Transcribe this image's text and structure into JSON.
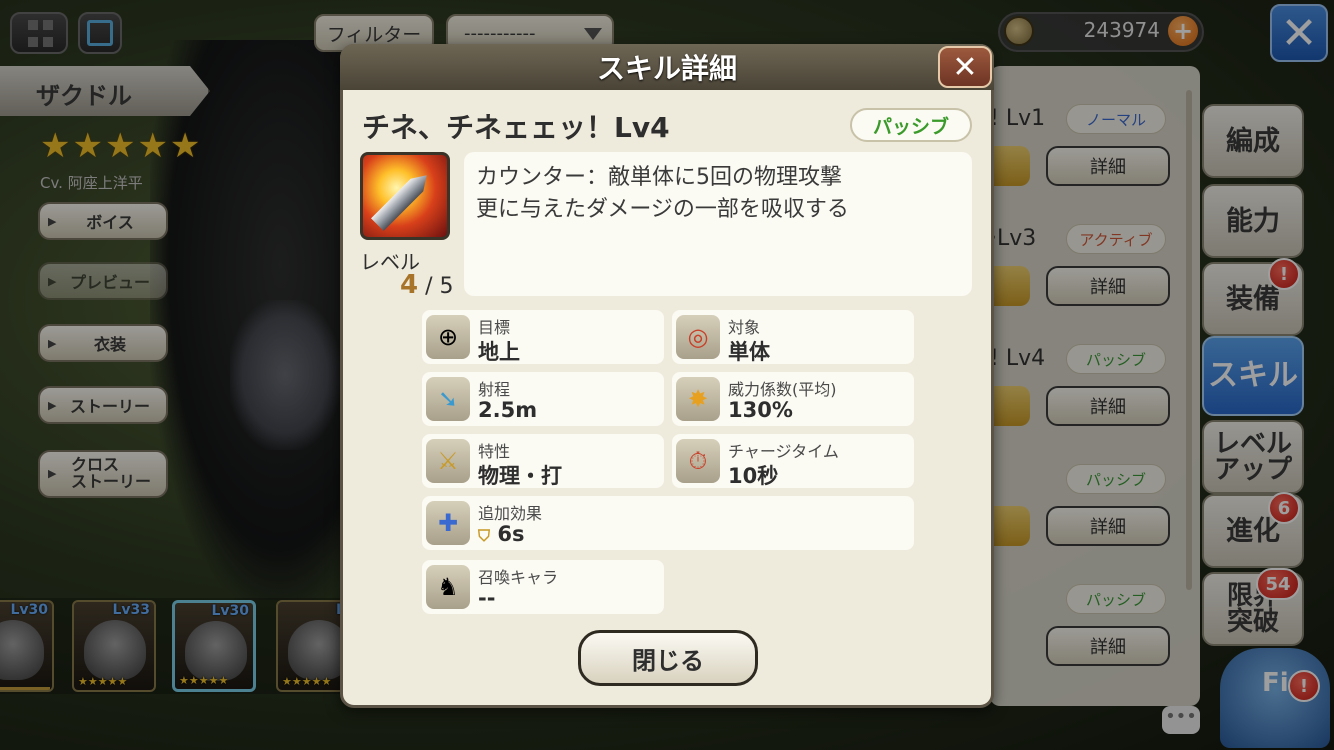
{
  "top_bar": {
    "filter_label": "フィルター",
    "select_value": "-----------",
    "coins": "243974",
    "coin_plus": "+",
    "close_symbol": "✕"
  },
  "character": {
    "name": "ザクドル",
    "stars": "★★★★★",
    "cv": "Cv. 阿座上洋平",
    "buttons": [
      "ボイス",
      "プレビュー",
      "衣装",
      "ストーリー",
      "クロス\nストーリー"
    ]
  },
  "roster": [
    {
      "level": "Lv30",
      "stars": "★★★★★"
    },
    {
      "level": "Lv33",
      "stars": "★★★★★"
    },
    {
      "level": "Lv30",
      "stars": "★★★★★"
    },
    {
      "level": "Lv",
      "stars": "★★★★★"
    }
  ],
  "skill_list": [
    {
      "name": "! Lv1",
      "tag": "ノーマル",
      "tag_type": "normal",
      "detail": "詳細"
    },
    {
      "name": "·Lv3",
      "tag": "アクティブ",
      "tag_type": "active",
      "detail": "詳細"
    },
    {
      "name": "! Lv4",
      "tag": "パッシブ",
      "tag_type": "passive",
      "detail": "詳細"
    },
    {
      "name": "",
      "tag": "パッシブ",
      "tag_type": "passive",
      "detail": "詳細"
    },
    {
      "name": "",
      "tag": "パッシブ",
      "tag_type": "passive",
      "detail": "詳細"
    }
  ],
  "right_tabs": [
    {
      "label": "編成",
      "badge": ""
    },
    {
      "label": "能力",
      "badge": ""
    },
    {
      "label": "装備",
      "badge": "!"
    },
    {
      "label": "スキル",
      "badge": "",
      "active": true
    },
    {
      "label": "レベル\nアップ",
      "badge": ""
    },
    {
      "label": "進化",
      "badge": "6"
    },
    {
      "label": "限界\n突破",
      "badge": "54"
    }
  ],
  "fiel_badge": "!",
  "chat_icon": "chat-bubble-icon",
  "modal": {
    "title": "スキル詳細",
    "close_symbol": "✕",
    "skill_name": "チネ、チネェェッ！Lv4",
    "type_tag": "パッシブ",
    "level_label": "レベル",
    "level_current": "4",
    "level_max": " / 5",
    "description": "カウンター：敵単体に5回の物理攻撃\n更に与えたダメージの一部を吸収する",
    "stats": {
      "target_label": "目標",
      "target_value": "地上",
      "scope_label": "対象",
      "scope_value": "単体",
      "range_label": "射程",
      "range_value": "2.5m",
      "power_label": "威力係数(平均)",
      "power_value": "130%",
      "trait_label": "特性",
      "trait_value": "物理・打",
      "charge_label": "チャージタイム",
      "charge_value": "10秒",
      "extra_label": "追加効果",
      "extra_value": "6s",
      "summon_label": "召喚キャラ",
      "summon_value": "--"
    },
    "close_button": "閉じる"
  },
  "colors": {
    "accent_blue": "#2a6acb",
    "passive_green": "#3a9a2a",
    "active_red": "#d05a3a",
    "normal_blue": "#3a6ad0",
    "badge_red": "#c81a14",
    "level_gold": "#a8742a"
  }
}
